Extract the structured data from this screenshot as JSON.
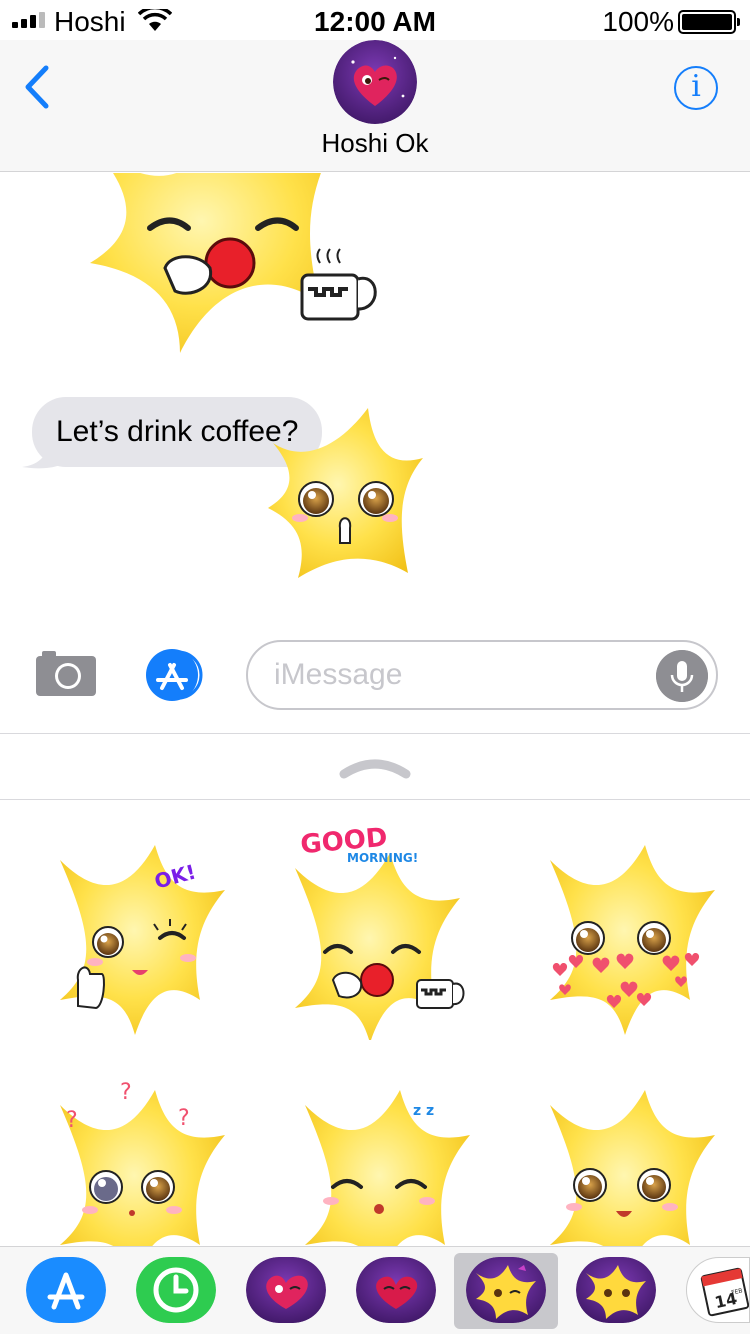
{
  "status_bar": {
    "carrier": "Hoshi",
    "time": "12:00 AM",
    "battery_percent": "100%",
    "battery_level": 1.0
  },
  "header": {
    "back_icon": "chevron-left-icon",
    "contact_name": "Hoshi Ok",
    "info_icon": "info-icon",
    "info_glyph": "i"
  },
  "conversation": {
    "message_text": "Let’s drink coffee?"
  },
  "composer": {
    "camera_icon": "camera-icon",
    "appstore_icon": "appstore-icon",
    "placeholder": "iMessage",
    "mic_icon": "microphone-icon"
  },
  "stickers": [
    {
      "name": "star-ok-wink",
      "caption": "OK!"
    },
    {
      "name": "star-good-morning-coffee",
      "caption_line1": "GOOD",
      "caption_line2": "MORNING!"
    },
    {
      "name": "star-hearts"
    },
    {
      "name": "star-confused",
      "caption": "?"
    },
    {
      "name": "star-sleepy",
      "caption": "z z"
    },
    {
      "name": "star-smile"
    }
  ],
  "app_drawer": [
    {
      "name": "app-store-app"
    },
    {
      "name": "recents-app"
    },
    {
      "name": "heart-sticker-pack-1"
    },
    {
      "name": "heart-sticker-pack-2"
    },
    {
      "name": "star-sticker-pack-selected",
      "selected": true
    },
    {
      "name": "star-sticker-pack-2"
    },
    {
      "name": "calendar-sticker-app",
      "label": "14",
      "month": "FEB"
    }
  ],
  "colors": {
    "ios_blue": "#147efb",
    "bubble_gray": "#e5e5ea",
    "star_yellow": "#ffd93d",
    "sticker_purple": "#5b2a86"
  }
}
